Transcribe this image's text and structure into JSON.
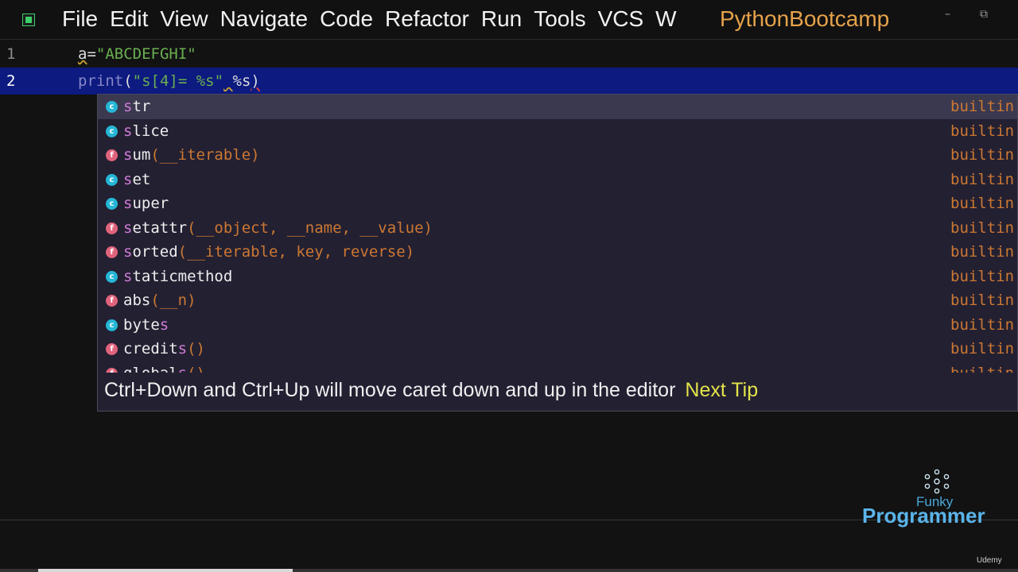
{
  "menu": {
    "items": [
      "File",
      "Edit",
      "View",
      "Navigate",
      "Code",
      "Refactor",
      "Run",
      "Tools",
      "VCS",
      "W"
    ],
    "project": "PythonBootcamp"
  },
  "window": {
    "minimize_glyph": "–",
    "restore_glyph": "⧉"
  },
  "editor": {
    "lines": [
      {
        "number": "1",
        "var": "a",
        "eq": "=",
        "string": "\"ABCDEFGHI\""
      },
      {
        "number": "2",
        "fn": "print",
        "open": "(",
        "string": "\"s[4]= %s\"",
        "rest_a": " ",
        "rest_b": "%s",
        "close": ")"
      }
    ]
  },
  "completion": {
    "typed": "s",
    "items": [
      {
        "kind": "c",
        "name_hl": "s",
        "name_rest": "tr",
        "sig": "",
        "type": "builtin"
      },
      {
        "kind": "c",
        "name_hl": "s",
        "name_rest": "lice",
        "sig": "",
        "type": "builtin"
      },
      {
        "kind": "f",
        "name_hl": "s",
        "name_rest": "um",
        "sig": "(__iterable)",
        "type": "builtin"
      },
      {
        "kind": "c",
        "name_hl": "s",
        "name_rest": "et",
        "sig": "",
        "type": "builtin"
      },
      {
        "kind": "c",
        "name_hl": "s",
        "name_rest": "uper",
        "sig": "",
        "type": "builtin"
      },
      {
        "kind": "f",
        "name_hl": "s",
        "name_rest": "etattr",
        "sig": "(__object, __name, __value)",
        "type": "builtin"
      },
      {
        "kind": "f",
        "name_hl": "s",
        "name_rest": "orted",
        "sig": "(__iterable, key, reverse)",
        "type": "builtin"
      },
      {
        "kind": "c",
        "name_hl": "s",
        "name_rest": "taticmethod",
        "sig": "",
        "type": "builtin"
      },
      {
        "kind": "f",
        "name_hl": "abs",
        "name_rest": "",
        "sig": "(__n)",
        "type": "builtin"
      },
      {
        "kind": "c",
        "name_hl": "byte",
        "name_rest": "s",
        "sig": "",
        "type": "builtin"
      },
      {
        "kind": "f",
        "name_hl": "credit",
        "name_rest": "s",
        "sig": "()",
        "type": "builtin"
      },
      {
        "kind": "f",
        "name_hl": "global",
        "name_rest": "s",
        "sig": "()",
        "type": "builtin"
      }
    ],
    "hint": "Ctrl+Down and Ctrl+Up will move caret down and up in the editor",
    "next_tip": "Next Tip"
  },
  "video_progress": 0.26,
  "watermark": {
    "funky": "Funky",
    "programmer": "Programmer",
    "udemy": "Udemy"
  },
  "colors": {
    "accent_class": "#26b6d6",
    "accent_function": "#e0637c",
    "selection": "#0d1a80",
    "orange": "#cc7832"
  }
}
